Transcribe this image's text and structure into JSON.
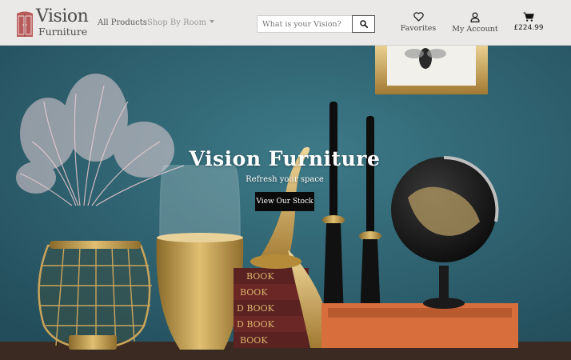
{
  "brand": {
    "name": "Vision",
    "sub": "Furniture",
    "accent": "#b85a5a"
  },
  "nav": {
    "all_products": "All Products",
    "shop_by_room": "Shop By Room"
  },
  "search": {
    "placeholder": "What is your Vision?",
    "value": ""
  },
  "user_nav": {
    "favorites": "Favorites",
    "my_account": "My Account",
    "cart_total": "£224.99"
  },
  "hero": {
    "title": "Vision Furniture",
    "subtitle": "Refresh your space",
    "cta": "View Our Stock"
  },
  "books": {
    "spines": [
      "BOOK",
      "BOOK",
      "D BOOK",
      "D BOOK",
      "BOOK",
      "BOOK"
    ]
  },
  "colors": {
    "navbar_bg": "#ebe9e8",
    "hero_wall": "#2f6171",
    "cta_bg": "#0b0b0b"
  }
}
